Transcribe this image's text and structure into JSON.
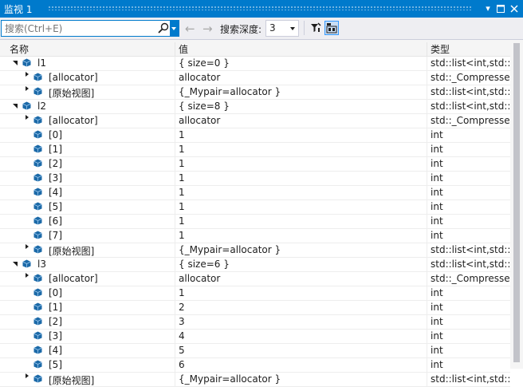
{
  "window": {
    "title": "监视 1"
  },
  "toolbar": {
    "search_placeholder": "搜索(Ctrl+E)",
    "depth_label": "搜索深度:",
    "depth_value": "3"
  },
  "columns": {
    "name": "名称",
    "value": "值",
    "type": "类型"
  },
  "rows": [
    {
      "indent": 0,
      "expander": "expanded",
      "name": "l1",
      "value": "{ size=0 }",
      "type": "std::list<int,std::a..."
    },
    {
      "indent": 1,
      "expander": "collapsed",
      "name": "[allocator]",
      "value": "allocator",
      "type": "std::_Compresse..."
    },
    {
      "indent": 1,
      "expander": "collapsed",
      "name": "[原始视图]",
      "value": "{_Mypair=allocator }",
      "type": "std::list<int,std::a..."
    },
    {
      "indent": 0,
      "expander": "expanded",
      "name": "l2",
      "value": "{ size=8 }",
      "type": "std::list<int,std::a..."
    },
    {
      "indent": 1,
      "expander": "collapsed",
      "name": "[allocator]",
      "value": "allocator",
      "type": "std::_Compresse..."
    },
    {
      "indent": 1,
      "expander": "none",
      "name": "[0]",
      "value": "1",
      "type": "int"
    },
    {
      "indent": 1,
      "expander": "none",
      "name": "[1]",
      "value": "1",
      "type": "int"
    },
    {
      "indent": 1,
      "expander": "none",
      "name": "[2]",
      "value": "1",
      "type": "int"
    },
    {
      "indent": 1,
      "expander": "none",
      "name": "[3]",
      "value": "1",
      "type": "int"
    },
    {
      "indent": 1,
      "expander": "none",
      "name": "[4]",
      "value": "1",
      "type": "int"
    },
    {
      "indent": 1,
      "expander": "none",
      "name": "[5]",
      "value": "1",
      "type": "int"
    },
    {
      "indent": 1,
      "expander": "none",
      "name": "[6]",
      "value": "1",
      "type": "int"
    },
    {
      "indent": 1,
      "expander": "none",
      "name": "[7]",
      "value": "1",
      "type": "int"
    },
    {
      "indent": 1,
      "expander": "collapsed",
      "name": "[原始视图]",
      "value": "{_Mypair=allocator }",
      "type": "std::list<int,std::a..."
    },
    {
      "indent": 0,
      "expander": "expanded",
      "name": "l3",
      "value": "{ size=6 }",
      "type": "std::list<int,std::a..."
    },
    {
      "indent": 1,
      "expander": "collapsed",
      "name": "[allocator]",
      "value": "allocator",
      "type": "std::_Compresse..."
    },
    {
      "indent": 1,
      "expander": "none",
      "name": "[0]",
      "value": "1",
      "type": "int"
    },
    {
      "indent": 1,
      "expander": "none",
      "name": "[1]",
      "value": "2",
      "type": "int"
    },
    {
      "indent": 1,
      "expander": "none",
      "name": "[2]",
      "value": "3",
      "type": "int"
    },
    {
      "indent": 1,
      "expander": "none",
      "name": "[3]",
      "value": "4",
      "type": "int"
    },
    {
      "indent": 1,
      "expander": "none",
      "name": "[4]",
      "value": "5",
      "type": "int"
    },
    {
      "indent": 1,
      "expander": "none",
      "name": "[5]",
      "value": "6",
      "type": "int"
    },
    {
      "indent": 1,
      "expander": "collapsed",
      "name": "[原始视图]",
      "value": "{_Mypair=allocator }",
      "type": "std::list<int,std::a..."
    }
  ],
  "colors": {
    "accent": "#007acc",
    "cube": "#1c6aa8",
    "header_bg": "#f5f5f5"
  }
}
